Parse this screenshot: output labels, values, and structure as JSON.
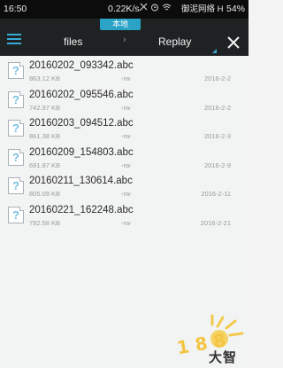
{
  "status_bar": {
    "time": "16:50",
    "speed": "0.22K/s",
    "carrier": "御泥网络 H",
    "battery": "54%"
  },
  "app_bar": {
    "storage_label": "本地",
    "tabs": [
      {
        "label": "files"
      },
      {
        "label": "Replay"
      }
    ],
    "separator": "›"
  },
  "files": [
    {
      "name": "20160202_093342.abc",
      "size": "863.12 KB",
      "perm": "-rw",
      "date": "2016-2-2"
    },
    {
      "name": "20160202_095546.abc",
      "size": "742.97 KB",
      "perm": "-rw",
      "date": "2016-2-2"
    },
    {
      "name": "20160203_094512.abc",
      "size": "861.38 KB",
      "perm": "-rw",
      "date": "2016-2-3"
    },
    {
      "name": "20160209_154803.abc",
      "size": "691.87 KB",
      "perm": "-rw",
      "date": "2016-2-9"
    },
    {
      "name": "20160211_130614.abc",
      "size": "805.09 KB",
      "perm": "-rw",
      "date": "2016-2-11"
    },
    {
      "name": "20160221_162248.abc",
      "size": "792.58 KB",
      "perm": "-rw",
      "date": "2016-2-21"
    }
  ],
  "watermark": {
    "text": "大智网汇"
  },
  "colors": {
    "accent": "#38a8d4",
    "storage_tab": "#2ba3c7",
    "appbar": "#1f2223",
    "background": "#f2f3f3"
  },
  "icons": {
    "menu": "menu-icon",
    "close": "close-icon",
    "file": "unknown-file-icon"
  }
}
